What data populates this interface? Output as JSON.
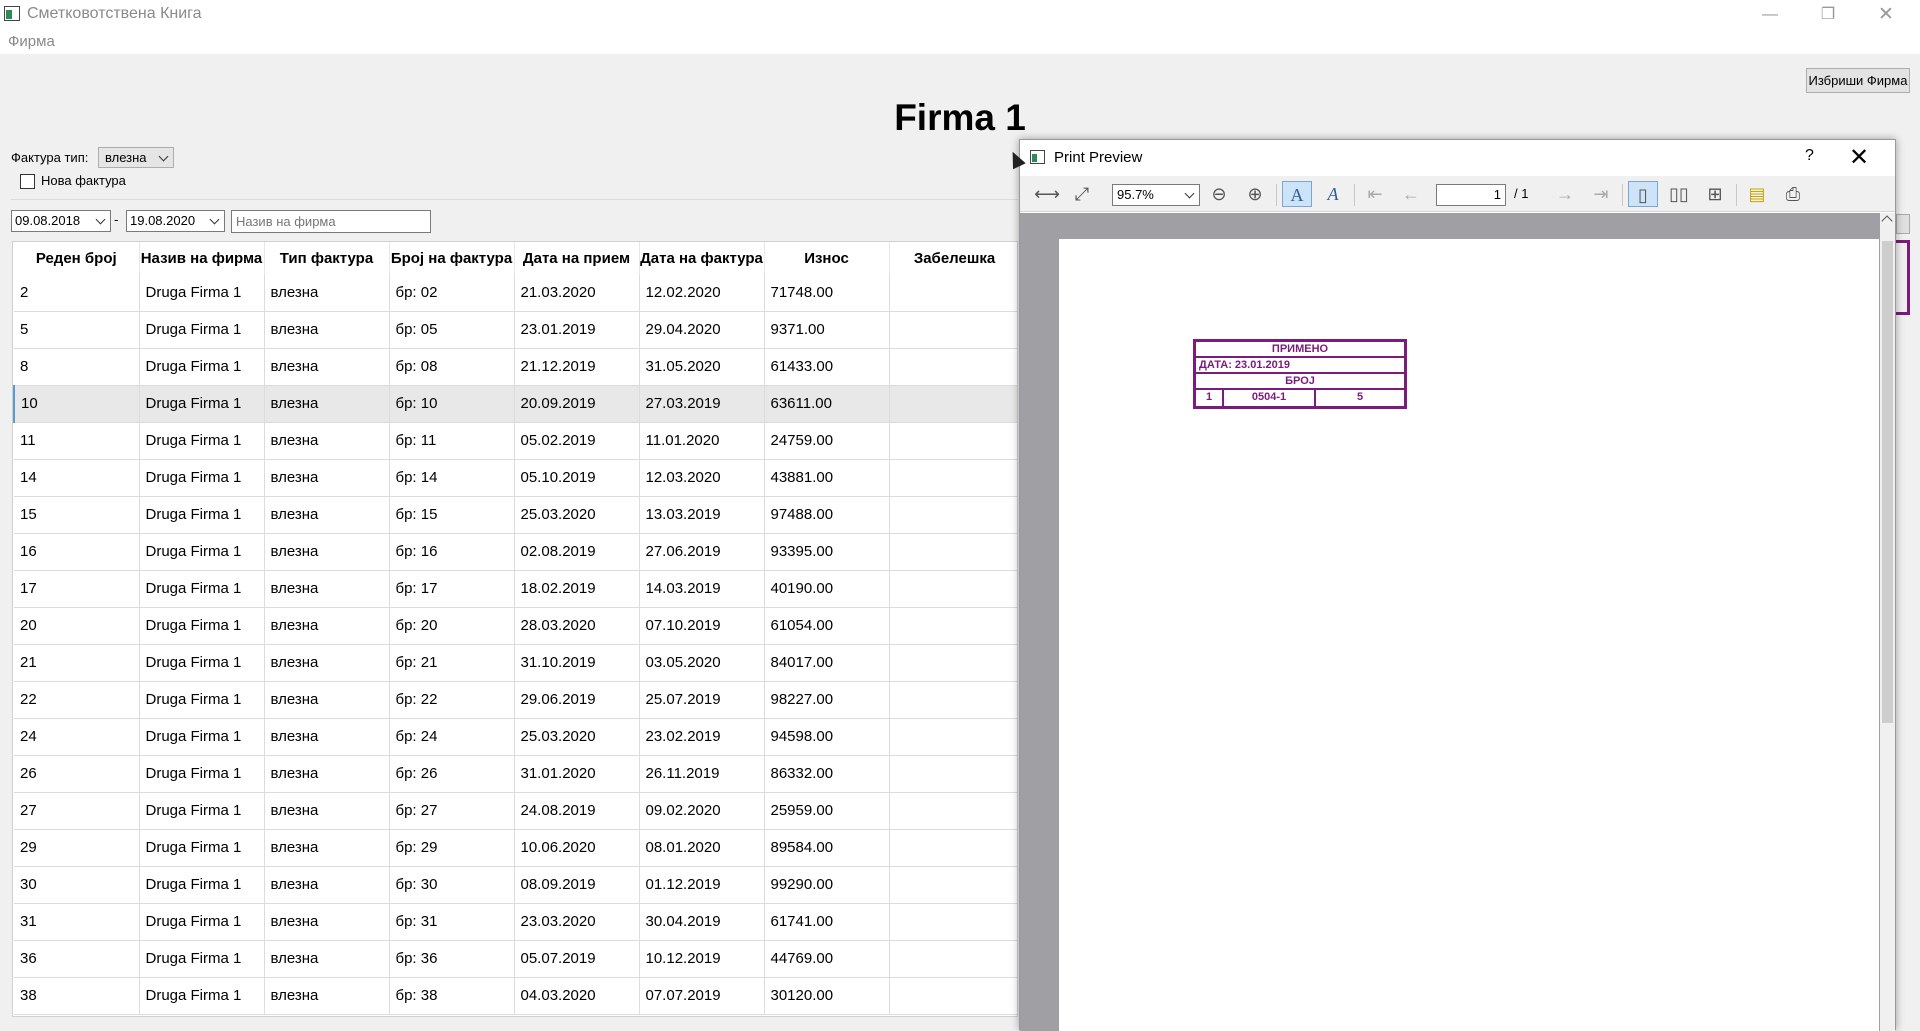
{
  "window": {
    "title": "Сметковотствена Книга",
    "minimize": "—",
    "maximize": "❐",
    "close": "✕"
  },
  "menu": {
    "firma": "Фирма"
  },
  "header": {
    "delete_button": "Избриши Фирма",
    "title": "Firma 1"
  },
  "filters": {
    "invoice_type_label": "Фактура тип:",
    "invoice_type_value": "влезна",
    "new_invoice_label": "Нова фактура",
    "date_from": "09.08.2018",
    "date_separator": "-",
    "date_to": "19.08.2020",
    "firm_name_placeholder": "Назив на фирма"
  },
  "table": {
    "columns": [
      "Реден број",
      "Назив на фирма",
      "Тип фактура",
      "Број на фактура",
      "Дата на прием",
      "Дата на фактура",
      "Износ",
      "Забелешка"
    ],
    "selected_row": 3,
    "rows": [
      [
        "2",
        "Druga Firma 1",
        "влезна",
        "бр: 02",
        "21.03.2020",
        "12.02.2020",
        "71748.00",
        ""
      ],
      [
        "5",
        "Druga Firma 1",
        "влезна",
        "бр: 05",
        "23.01.2019",
        "29.04.2020",
        "9371.00",
        ""
      ],
      [
        "8",
        "Druga Firma 1",
        "влезна",
        "бр: 08",
        "21.12.2019",
        "31.05.2020",
        "61433.00",
        ""
      ],
      [
        "10",
        "Druga Firma 1",
        "влезна",
        "бр: 10",
        "20.09.2019",
        "27.03.2019",
        "63611.00",
        ""
      ],
      [
        "11",
        "Druga Firma 1",
        "влезна",
        "бр: 11",
        "05.02.2019",
        "11.01.2020",
        "24759.00",
        ""
      ],
      [
        "14",
        "Druga Firma 1",
        "влезна",
        "бр: 14",
        "05.10.2019",
        "12.03.2020",
        "43881.00",
        ""
      ],
      [
        "15",
        "Druga Firma 1",
        "влезна",
        "бр: 15",
        "25.03.2020",
        "13.03.2019",
        "97488.00",
        ""
      ],
      [
        "16",
        "Druga Firma 1",
        "влезна",
        "бр: 16",
        "02.08.2019",
        "27.06.2019",
        "93395.00",
        ""
      ],
      [
        "17",
        "Druga Firma 1",
        "влезна",
        "бр: 17",
        "18.02.2019",
        "14.03.2019",
        "40190.00",
        ""
      ],
      [
        "20",
        "Druga Firma 1",
        "влезна",
        "бр: 20",
        "28.03.2020",
        "07.10.2019",
        "61054.00",
        ""
      ],
      [
        "21",
        "Druga Firma 1",
        "влезна",
        "бр: 21",
        "31.10.2019",
        "03.05.2020",
        "84017.00",
        ""
      ],
      [
        "22",
        "Druga Firma 1",
        "влезна",
        "бр: 22",
        "29.06.2019",
        "25.07.2019",
        "98227.00",
        ""
      ],
      [
        "24",
        "Druga Firma 1",
        "влезна",
        "бр: 24",
        "25.03.2020",
        "23.02.2019",
        "94598.00",
        ""
      ],
      [
        "26",
        "Druga Firma 1",
        "влезна",
        "бр: 26",
        "31.01.2020",
        "26.11.2019",
        "86332.00",
        ""
      ],
      [
        "27",
        "Druga Firma 1",
        "влезна",
        "бр: 27",
        "24.08.2019",
        "09.02.2020",
        "25959.00",
        ""
      ],
      [
        "29",
        "Druga Firma 1",
        "влезна",
        "бр: 29",
        "10.06.2020",
        "08.01.2020",
        "89584.00",
        ""
      ],
      [
        "30",
        "Druga Firma 1",
        "влезна",
        "бр: 30",
        "08.09.2019",
        "01.12.2019",
        "99290.00",
        ""
      ],
      [
        "31",
        "Druga Firma 1",
        "влезна",
        "бр: 31",
        "23.03.2020",
        "30.04.2019",
        "61741.00",
        ""
      ],
      [
        "36",
        "Druga Firma 1",
        "влезна",
        "бр: 36",
        "05.07.2019",
        "10.12.2019",
        "44769.00",
        ""
      ],
      [
        "38",
        "Druga Firma 1",
        "влезна",
        "бр: 38",
        "04.03.2020",
        "07.07.2019",
        "30120.00",
        ""
      ]
    ]
  },
  "preview": {
    "title": "Print Preview",
    "help": "?",
    "close": "✕",
    "zoom": "95.7%",
    "page_current": "1",
    "page_total": "/ 1",
    "stamp": {
      "heading": "ПРИМЕНО",
      "date": "ДАТА: 23.01.2019",
      "number_label": "БРОЈ",
      "cell1": "1",
      "cell2": "0504-1",
      "cell3": "5"
    },
    "stamp_color": "#7b1b7b"
  }
}
